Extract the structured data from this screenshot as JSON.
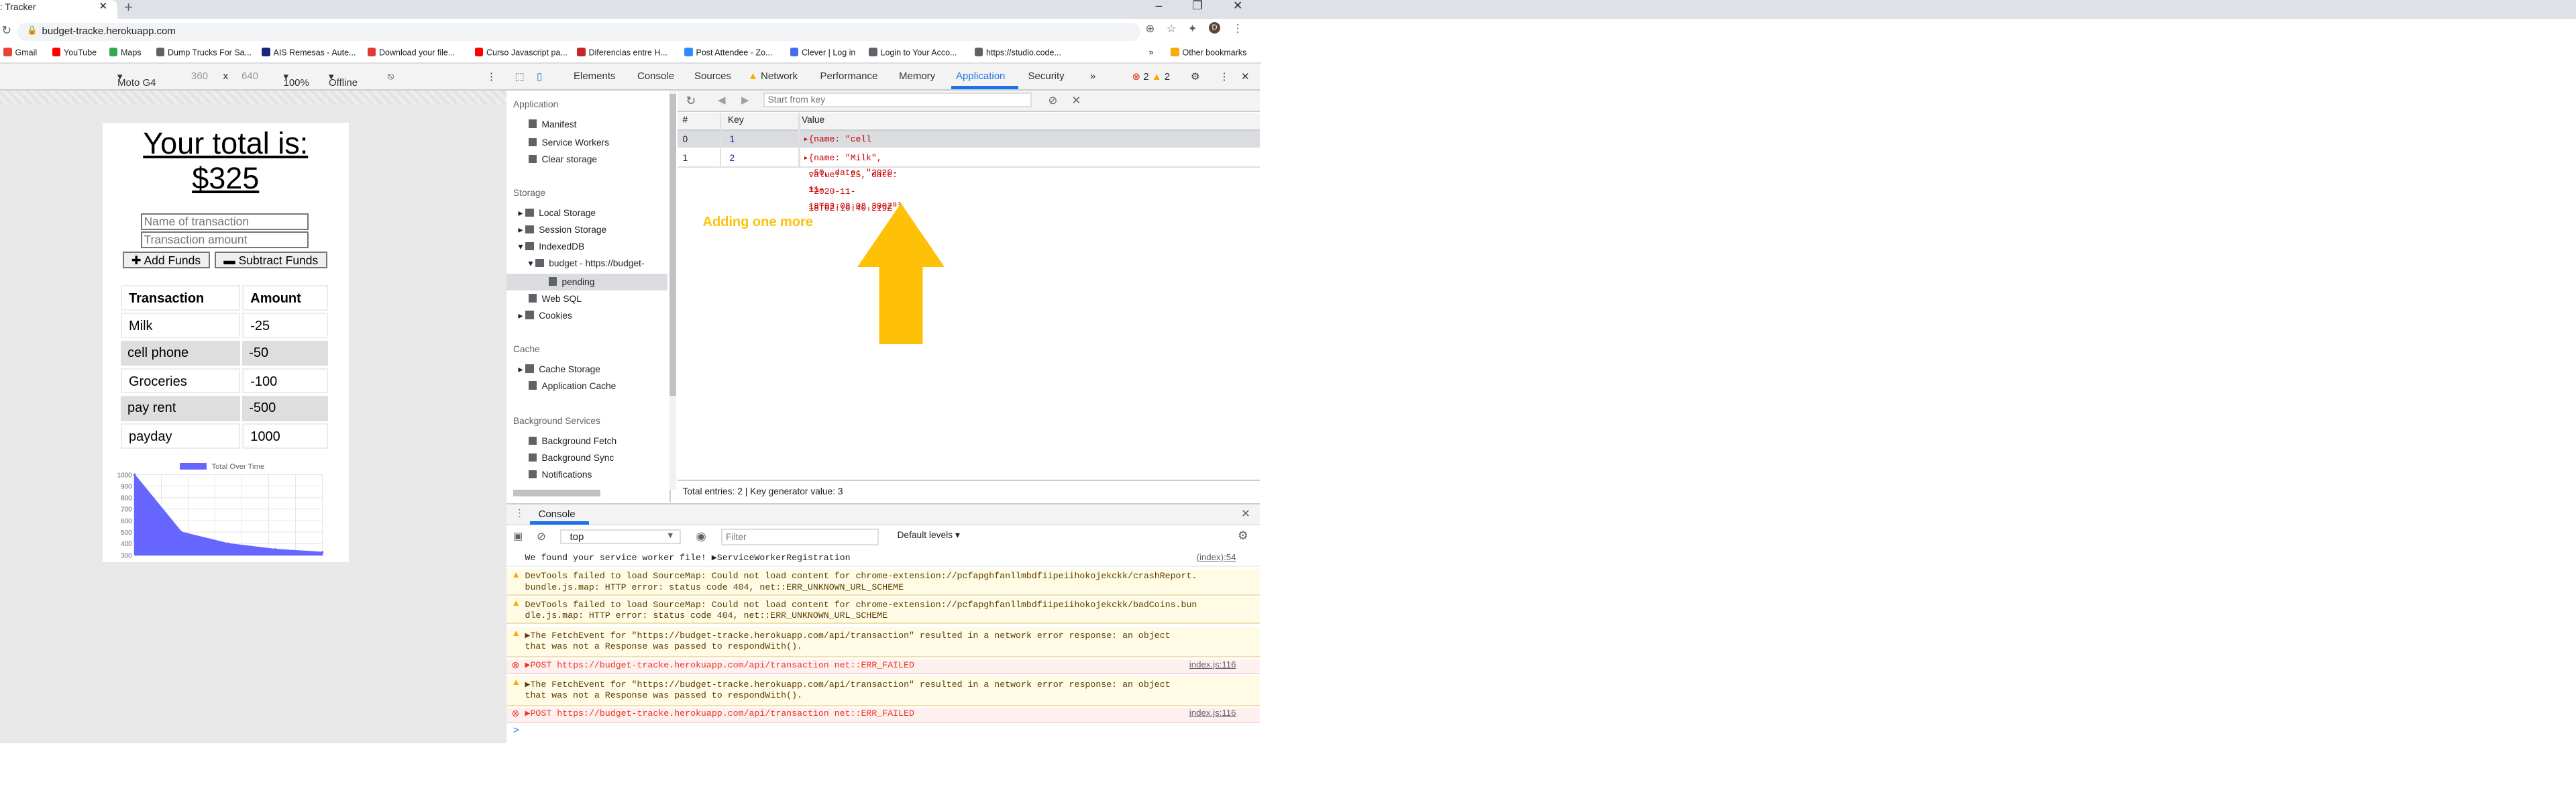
{
  "browser": {
    "tab_title": ": Tracker",
    "url": "budget-tracke.herokuapp.com",
    "avatar_letter": "D",
    "bookmarks": [
      {
        "label": "Gmail",
        "color": "#ea4335"
      },
      {
        "label": "YouTube",
        "color": "#ff0000"
      },
      {
        "label": "Maps",
        "color": "#34a853"
      },
      {
        "label": "Dump Trucks For Sa...",
        "color": "#5f6368"
      },
      {
        "label": "AIS Remesas - Aute...",
        "color": "#1a237e"
      },
      {
        "label": "Download your file...",
        "color": "#e53935"
      },
      {
        "label": "Curso Javascript pa...",
        "color": "#ff0000"
      },
      {
        "label": "Diferencias entre H...",
        "color": "#c62828"
      },
      {
        "label": "Post Attendee - Zo...",
        "color": "#2d8cff"
      },
      {
        "label": "Clever | Log in",
        "color": "#436cf2"
      },
      {
        "label": "Login to Your Acco...",
        "color": "#5f6368"
      },
      {
        "label": "https://studio.code...",
        "color": "#5f6368"
      }
    ],
    "other_bookmarks": "Other bookmarks",
    "more_bookmarks": "»"
  },
  "device_toolbar": {
    "device": "Moto G4",
    "width": "360",
    "times": "x",
    "height": "640",
    "zoom": "100%",
    "network": "Offline"
  },
  "app": {
    "total_line1": "Your total is:",
    "total_line2": "$325",
    "name_placeholder": "Name of transaction",
    "amount_placeholder": "Transaction amount",
    "add_button": "Add Funds",
    "subtract_button": "Subtract Funds",
    "table_headers": [
      "Transaction",
      "Amount"
    ],
    "transactions": [
      {
        "name": "Milk",
        "amount": "-25"
      },
      {
        "name": "cell phone",
        "amount": "-50"
      },
      {
        "name": "Groceries",
        "amount": "-100"
      },
      {
        "name": "pay rent",
        "amount": "-500"
      },
      {
        "name": "payday",
        "amount": "1000"
      }
    ]
  },
  "chart_data": {
    "type": "area",
    "title": "",
    "legend": [
      "Total Over Time"
    ],
    "legend_placement": "top-center",
    "series": [
      {
        "name": "Total Over Time",
        "values": [
          1000,
          500,
          400,
          350,
          325
        ]
      }
    ],
    "y_ticks": [
      1000,
      900,
      800,
      700,
      600,
      500,
      400,
      300
    ],
    "ylim": [
      300,
      1000
    ],
    "grid": true,
    "fill_color": "#6666ff"
  },
  "devtools": {
    "tabs": [
      "Elements",
      "Console",
      "Sources",
      "Network",
      "Performance",
      "Memory",
      "Application",
      "Security",
      "»"
    ],
    "active_tab": "Application",
    "error_count": "2",
    "warning_count": "2",
    "sidebar": {
      "application_header": "Application",
      "application_items": [
        "Manifest",
        "Service Workers",
        "Clear storage"
      ],
      "storage_header": "Storage",
      "storage_items": [
        "Local Storage",
        "Session Storage",
        "IndexedDB",
        "budget - https://budget-",
        "pending",
        "Web SQL",
        "Cookies"
      ],
      "cache_header": "Cache",
      "cache_items": [
        "Cache Storage",
        "Application Cache"
      ],
      "bg_header": "Background Services",
      "bg_items": [
        "Background Fetch",
        "Background Sync",
        "Notifications"
      ]
    },
    "key_filter_placeholder": "Start from key",
    "grid_headers": [
      "#",
      "Key",
      "Value"
    ],
    "rows": [
      {
        "index": "0",
        "key": "1",
        "value": "{name: \"cell phone\", value: -50, date: \"2020-11-18T02:08:08.390Z\"}"
      },
      {
        "index": "1",
        "key": "2",
        "value": "{name: \"Milk\", value: -25, date: \"2020-11-18T02:16:40.219Z\"}"
      }
    ],
    "annotation": "Adding one more",
    "arrow_color": "#ffc107",
    "footer": "Total entries: 2  |  Key generator value: 3",
    "console_tab": "Console",
    "context": "top",
    "filter_placeholder": "Filter",
    "levels": "Default levels",
    "messages": [
      {
        "level": "info",
        "lines": [
          "We found your service worker file! ▶ServiceWorkerRegistration"
        ],
        "source": "(index):54"
      },
      {
        "level": "warn",
        "lines": [
          "DevTools failed to load SourceMap: Could not load content for chrome-extension://pcfapghfanllmbdfiipeiihokojekckk/crashReport.",
          "bundle.js.map: HTTP error: status code 404, net::ERR_UNKNOWN_URL_SCHEME"
        ],
        "source": ""
      },
      {
        "level": "warn",
        "lines": [
          "DevTools failed to load SourceMap: Could not load content for chrome-extension://pcfapghfanllmbdfiipeiihokojekckk/badCoins.bun",
          "dle.js.map: HTTP error: status code 404, net::ERR_UNKNOWN_URL_SCHEME"
        ],
        "source": ""
      },
      {
        "level": "warn",
        "lines": [
          "▶The FetchEvent for \"https://budget-tracke.herokuapp.com/api/transaction\" resulted in a network error response: an object",
          "that was not a Response was passed to respondWith()."
        ],
        "source": ""
      },
      {
        "level": "err",
        "lines": [
          "▶POST https://budget-tracke.herokuapp.com/api/transaction net::ERR_FAILED"
        ],
        "source": "index.js:116"
      },
      {
        "level": "warn",
        "lines": [
          "▶The FetchEvent for \"https://budget-tracke.herokuapp.com/api/transaction\" resulted in a network error response: an object",
          "that was not a Response was passed to respondWith()."
        ],
        "source": ""
      },
      {
        "level": "err",
        "lines": [
          "▶POST https://budget-tracke.herokuapp.com/api/transaction net::ERR_FAILED"
        ],
        "source": "index.js:116"
      }
    ],
    "prompt": ">"
  }
}
